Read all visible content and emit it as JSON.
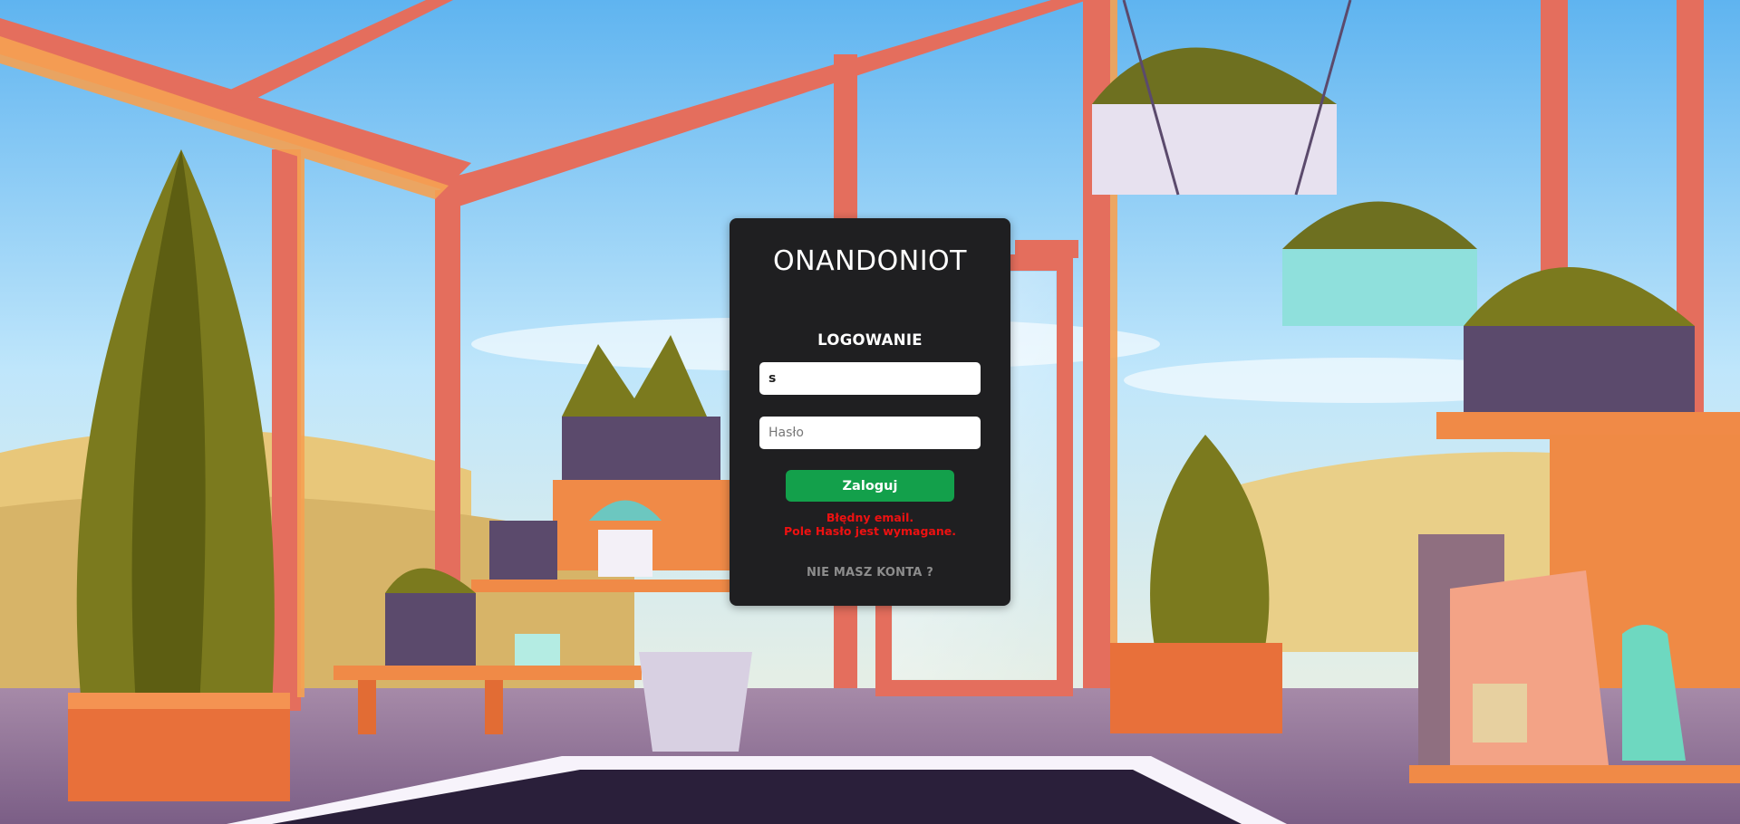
{
  "app": {
    "brand": "ONANDONIOT"
  },
  "login": {
    "title": "LOGOWANIE",
    "email_value": "s",
    "password_placeholder": "Hasło",
    "submit_label": "Zaloguj",
    "errors": [
      "Błędny email.",
      "Pole Hasło jest wymagane."
    ],
    "register_link": "NIE MASZ KONTA ?"
  },
  "colors": {
    "card_bg": "#1f1f21",
    "button_bg": "#13a04b",
    "error_text": "#ee1111",
    "muted_text": "#8d8d8d"
  }
}
